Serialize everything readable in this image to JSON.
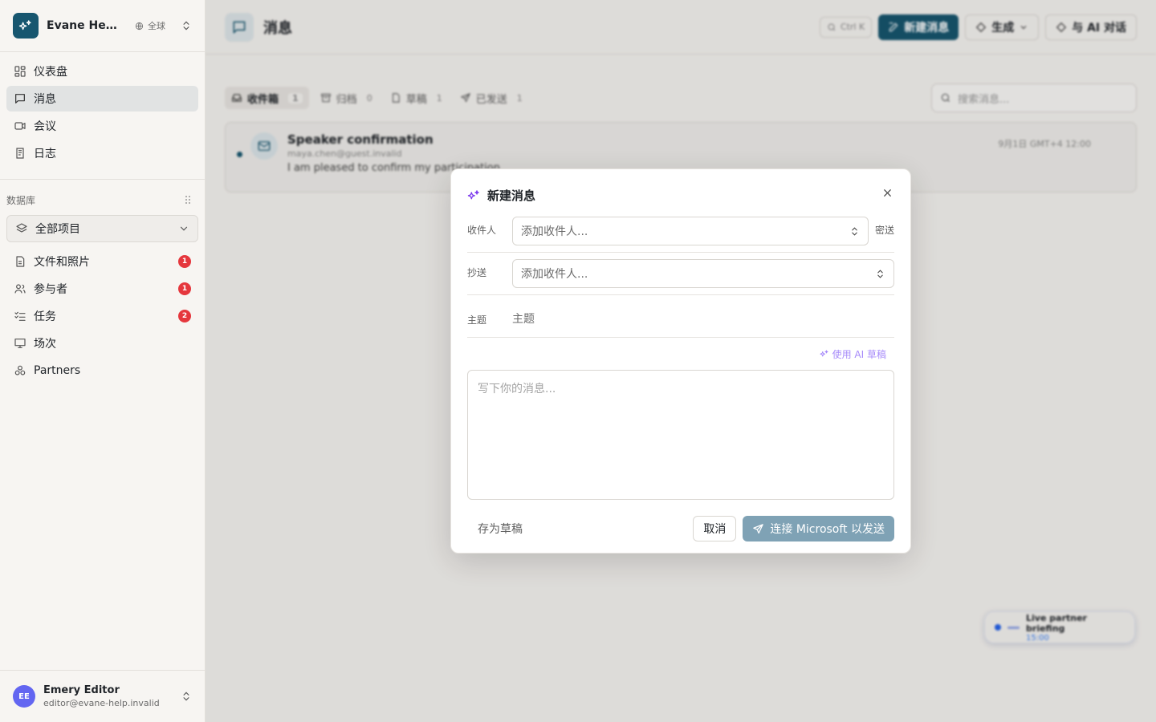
{
  "sidebar": {
    "workspace_name": "Evane Help ...",
    "scope_label": "全球",
    "nav": [
      {
        "label": "仪表盘"
      },
      {
        "label": "消息"
      },
      {
        "label": "会议"
      },
      {
        "label": "日志"
      }
    ],
    "db_section_label": "数据库",
    "db_select_label": "全部项目",
    "db_items": [
      {
        "label": "文件和照片",
        "badge": "1"
      },
      {
        "label": "参与者",
        "badge": "1"
      },
      {
        "label": "任务",
        "badge": "2"
      },
      {
        "label": "场次",
        "badge": ""
      },
      {
        "label": "Partners",
        "badge": ""
      }
    ],
    "user": {
      "initials": "EE",
      "name": "Emery Editor",
      "email": "editor@evane-help.invalid"
    }
  },
  "main": {
    "title": "消息",
    "shortcut_label": "Ctrl K",
    "new_message_label": "新建消息",
    "generate_label": "生成",
    "ai_chat_label": "与 AI 对话",
    "tabs": [
      {
        "label": "收件箱",
        "count": "1"
      },
      {
        "label": "归档",
        "count": "0"
      },
      {
        "label": "草稿",
        "count": "1"
      },
      {
        "label": "已发送",
        "count": "1"
      }
    ],
    "search_placeholder": "搜索消息...",
    "message": {
      "subject": "Speaker confirmation",
      "from": "maya.chen@guest.invalid",
      "preview": "I am pleased to confirm my participation",
      "time": "9月1日 GMT+4 12:00"
    },
    "live": {
      "title": "Live partner briefing",
      "time": "15:00"
    }
  },
  "modal": {
    "title": "新建消息",
    "to_label": "收件人",
    "to_placeholder": "添加收件人...",
    "bcc_label": "密送",
    "cc_label": "抄送",
    "cc_placeholder": "添加收件人...",
    "subject_label": "主题",
    "subject_placeholder": "主题",
    "ai_draft_label": "使用 AI 草稿",
    "body_placeholder": "写下你的消息...",
    "save_draft_label": "存为草稿",
    "cancel_label": "取消",
    "send_label": "连接 Microsoft 以发送"
  },
  "colors": {
    "brand": "#17566f",
    "badge": "#e5373d",
    "ai_accent": "#a78bfa",
    "send_disabled": "#7fa2b5"
  }
}
